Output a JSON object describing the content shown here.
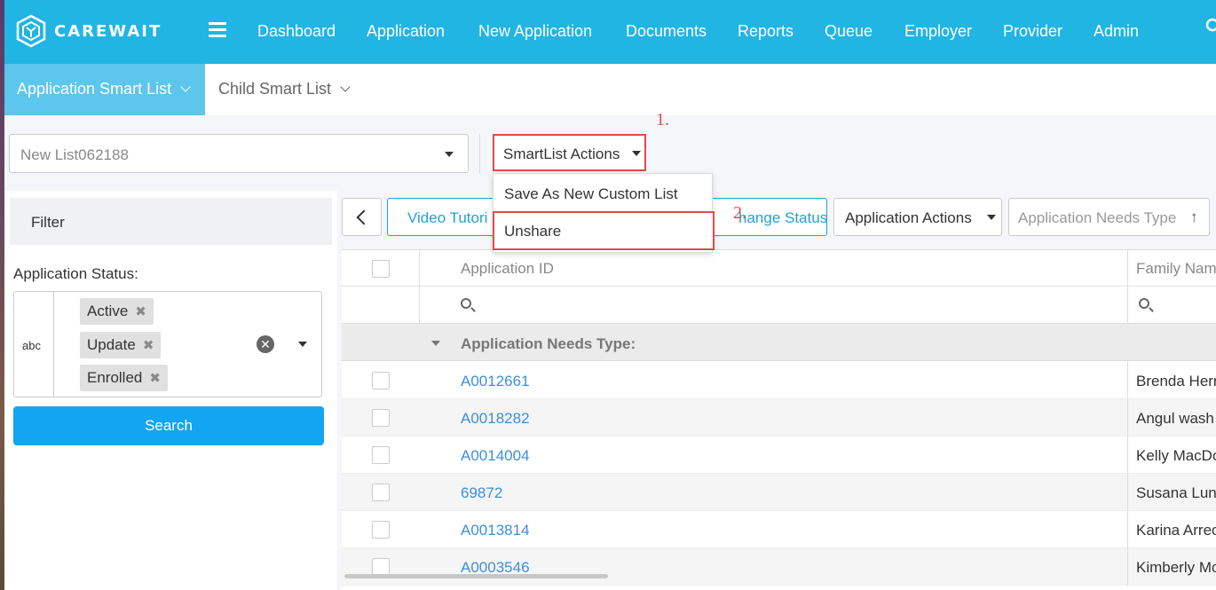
{
  "app": {
    "brand": "CAREWAIT"
  },
  "navbar": {
    "items": [
      "Dashboard",
      "Application",
      "New Application",
      "Documents",
      "Reports",
      "Queue",
      "Employer",
      "Provider",
      "Admin"
    ]
  },
  "subtabs": {
    "active": "Application Smart List",
    "other": "Child Smart List"
  },
  "list_selector": {
    "value": "New List062188"
  },
  "smartlist_actions": {
    "label": "SmartList Actions",
    "menu": [
      "Save As New Custom List",
      "Unshare"
    ]
  },
  "markers": {
    "step1": "1.",
    "step2": "2."
  },
  "filter": {
    "header": "Filter",
    "status_label": "Application Status:",
    "type_icon": "abc",
    "tags": [
      "Active",
      "Update",
      "Enrolled"
    ],
    "search_button": "Search"
  },
  "toolbar": {
    "video_label": "Video Tutori",
    "change_status_label": "hange Status",
    "app_actions_label": "Application Actions",
    "needs_type_placeholder": "Application Needs Type"
  },
  "grid": {
    "columns": [
      "Application ID",
      "Family Nam"
    ],
    "group_label": "Application Needs Type:",
    "rows": [
      {
        "id": "A0012661",
        "name": "Brenda Hern"
      },
      {
        "id": "A0018282",
        "name": "Angul wash"
      },
      {
        "id": "A0014004",
        "name": "Kelly MacDo"
      },
      {
        "id": "69872",
        "name": "Susana Luna"
      },
      {
        "id": "A0013814",
        "name": "Karina Arrec"
      },
      {
        "id": "A0003546",
        "name": "Kimberly Mc"
      }
    ]
  },
  "colors": {
    "navbar": "#21b5e3",
    "active_tab": "#5cc6ec",
    "search_button": "#13a5f2",
    "highlight": "#e34b4b",
    "link": "#3d8fdc"
  }
}
